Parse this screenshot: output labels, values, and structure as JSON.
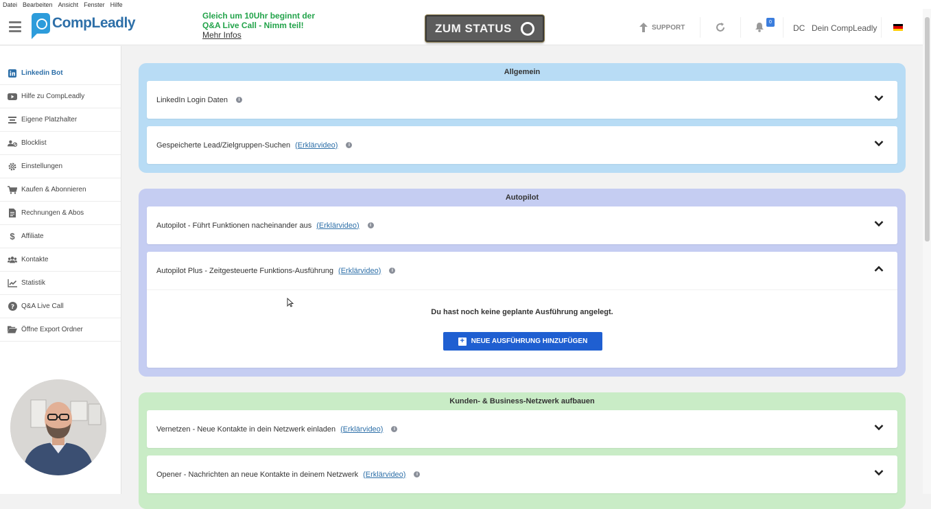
{
  "menubar": {
    "items": [
      "Datei",
      "Bearbeiten",
      "Ansicht",
      "Fenster",
      "Hilfe"
    ]
  },
  "header": {
    "logo_text": "CompLeadly",
    "announcement_line1": "Gleich um 10Uhr beginnt der",
    "announcement_line2": "Q&A Live Call - Nimm teil!",
    "announcement_link": "Mehr Infos",
    "status_button": "ZUM STATUS",
    "support_label": "SUPPORT",
    "notification_count": "0",
    "user_initials": "DC",
    "user_name": "Dein CompLeadly",
    "language": "de"
  },
  "sidebar": {
    "items": [
      {
        "label": "Linkedin Bot",
        "icon": "linkedin-icon",
        "active": true
      },
      {
        "label": "Hilfe zu CompLeadly",
        "icon": "youtube-icon",
        "active": false
      },
      {
        "label": "Eigene Platzhalter",
        "icon": "placeholder-icon",
        "active": false
      },
      {
        "label": "Blocklist",
        "icon": "blocklist-icon",
        "active": false
      },
      {
        "label": "Einstellungen",
        "icon": "gear-icon",
        "active": false
      },
      {
        "label": "Kaufen & Abonnieren",
        "icon": "cart-icon",
        "active": false
      },
      {
        "label": "Rechnungen & Abos",
        "icon": "invoice-icon",
        "active": false
      },
      {
        "label": "Affiliate",
        "icon": "dollar-icon",
        "active": false
      },
      {
        "label": "Kontakte",
        "icon": "users-icon",
        "active": false
      },
      {
        "label": "Statistik",
        "icon": "chart-icon",
        "active": false
      },
      {
        "label": "Q&A Live Call",
        "icon": "question-icon",
        "active": false
      },
      {
        "label": "Öffne Export Ordner",
        "icon": "folder-icon",
        "active": false
      }
    ]
  },
  "sections": {
    "allgemein": {
      "title": "Allgemein",
      "color": "#b8dcf5",
      "cards": [
        {
          "label": "LinkedIn Login Daten",
          "link": "",
          "expanded": false
        },
        {
          "label": "Gespeicherte Lead/Zielgruppen-Suchen",
          "link": "(Erklärvideo)",
          "expanded": false
        }
      ]
    },
    "autopilot": {
      "title": "Autopilot",
      "color": "#c5cdf2",
      "cards": [
        {
          "label": "Autopilot - Führt Funktionen nacheinander aus",
          "link": "(Erklärvideo)",
          "expanded": false
        },
        {
          "label": "Autopilot Plus - Zeitgesteuerte Funktions-Ausführung",
          "link": "(Erklärvideo)",
          "expanded": true,
          "empty_message": "Du hast noch keine geplante Ausführung angelegt.",
          "add_button": "NEUE AUSFÜHRUNG HINZUFÜGEN"
        }
      ]
    },
    "netzwerk": {
      "title": "Kunden- & Business-Netzwerk aufbauen",
      "color": "#c9ecc6",
      "cards": [
        {
          "label": "Vernetzen - Neue Kontakte in dein Netzwerk einladen",
          "link": "(Erklärvideo)",
          "expanded": false
        },
        {
          "label": "Opener - Nachrichten an neue Kontakte in deinem Netzwerk",
          "link": "(Erklärvideo)",
          "expanded": false
        }
      ]
    }
  }
}
